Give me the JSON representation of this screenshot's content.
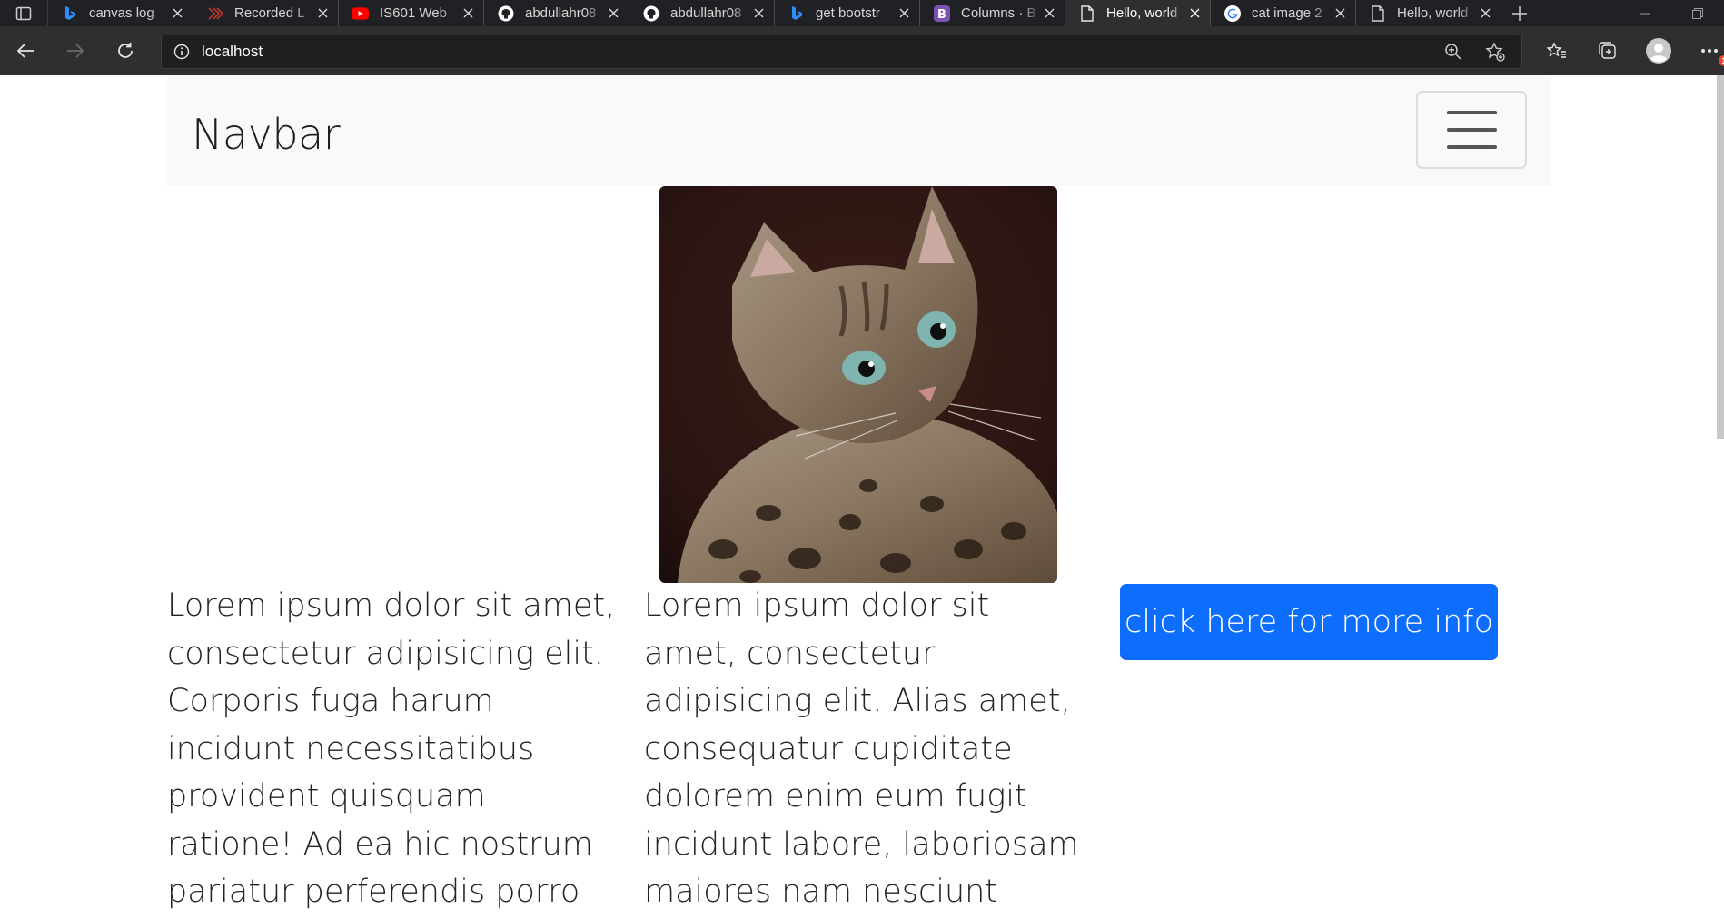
{
  "browser": {
    "tabs": [
      {
        "title": "canvas log",
        "icon": "bing-icon"
      },
      {
        "title": "Recorded L",
        "icon": "recorded-lecture-icon"
      },
      {
        "title": "IS601 Web",
        "icon": "youtube-icon"
      },
      {
        "title": "abdullahr08",
        "icon": "github-icon"
      },
      {
        "title": "abdullahr08",
        "icon": "github-icon"
      },
      {
        "title": "get bootstr",
        "icon": "bing-icon"
      },
      {
        "title": "Columns · B",
        "icon": "bootstrap-icon"
      },
      {
        "title": "Hello, world",
        "icon": "page-icon",
        "active": true
      },
      {
        "title": "cat image 2",
        "icon": "google-icon"
      },
      {
        "title": "Hello, world",
        "icon": "page-icon"
      }
    ],
    "address": {
      "url": "localhost"
    },
    "notification_badge": "1"
  },
  "navbar": {
    "brand": "Navbar"
  },
  "content": {
    "image_alt": "cat image",
    "column1_text": "Lorem ipsum dolor sit amet, consectetur adipisicing elit. Corporis fuga harum incidunt necessitatibus provident quisquam ratione! Ad ea hic nostrum pariatur perferendis porro quis quod, rerum. Ab",
    "column2_text": "Lorem ipsum dolor sit amet, consectetur adipisicing elit. Alias amet, consequatur cupiditate dolorem enim eum fugit incidunt labore, laboriosam maiores nam nesciunt possimus quae",
    "button_label": "click here for more info"
  },
  "colors": {
    "primary": "#0d6efd",
    "navbar_bg": "#f8f9fa",
    "chrome_dark": "#202124"
  }
}
